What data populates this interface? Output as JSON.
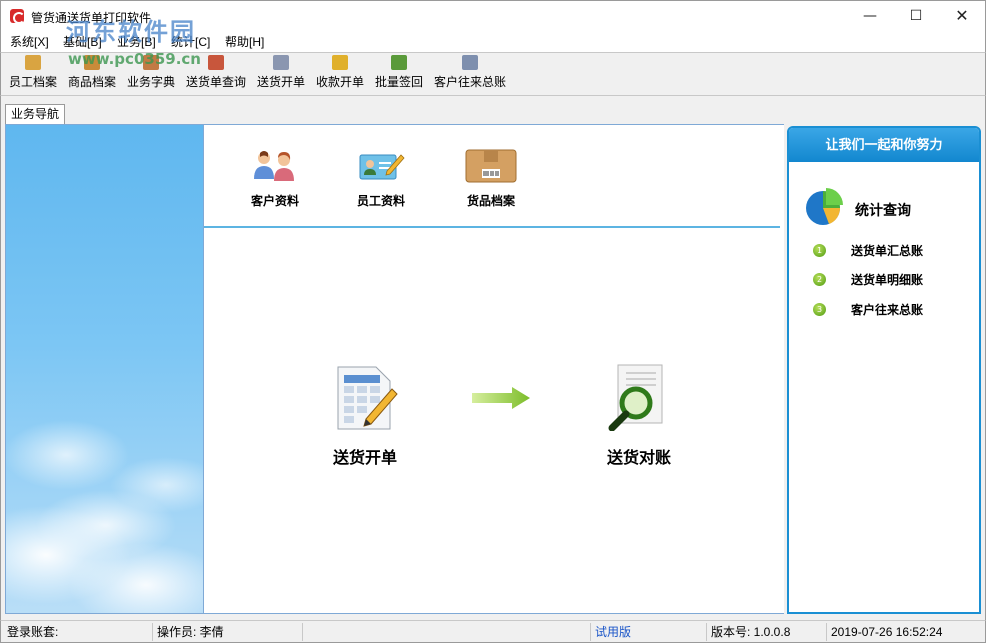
{
  "window": {
    "title": "管货通送货单打印软件",
    "watermark_text": "河东软件园",
    "watermark_url": "www.pc0359.cn",
    "minimize_glyph": "—",
    "maximize_glyph": "☐",
    "close_glyph": "✕"
  },
  "menu": {
    "items": [
      {
        "label": "系统[X]"
      },
      {
        "label": "基础[B]"
      },
      {
        "label": "业务[B]"
      },
      {
        "label": "统计[C]"
      },
      {
        "label": "帮助[H]"
      }
    ]
  },
  "toolbar": {
    "items": [
      {
        "label": "员工档案",
        "icon": "employee-icon",
        "color": "#d9a441"
      },
      {
        "label": "商品档案",
        "icon": "goods-icon",
        "color": "#c98b3a"
      },
      {
        "label": "业务字典",
        "icon": "dictionary-icon",
        "color": "#c27a44"
      },
      {
        "label": "送货单查询",
        "icon": "query-icon",
        "color": "#c8563c"
      },
      {
        "label": "送货开单",
        "icon": "delivery-icon",
        "color": "#8a96b0"
      },
      {
        "label": "收款开单",
        "icon": "payment-icon",
        "color": "#e0b02c"
      },
      {
        "label": "批量签回",
        "icon": "batch-sign-icon",
        "color": "#5a9a3a"
      },
      {
        "label": "客户往来总账",
        "icon": "ledger-icon",
        "color": "#7e8fae"
      }
    ]
  },
  "tabs": [
    {
      "label": "业务导航"
    }
  ],
  "quick_access": [
    {
      "label": "客户资料",
      "icon": "customers-icon"
    },
    {
      "label": "员工资料",
      "icon": "employee-card-icon"
    },
    {
      "label": "货品档案",
      "icon": "goods-box-icon"
    }
  ],
  "flow": {
    "start_label": "送货开单",
    "end_label": "送货对账"
  },
  "right_panel": {
    "header": "让我们一起和你努力",
    "section_title": "统计查询",
    "links": [
      {
        "num": "1",
        "label": "送货单汇总账"
      },
      {
        "num": "2",
        "label": "送货单明细账"
      },
      {
        "num": "3",
        "label": "客户往来总账"
      }
    ]
  },
  "status": {
    "account": "登录账套:",
    "operator": "操作员: 李倩",
    "trial": "试用版",
    "version": "版本号: 1.0.0.8",
    "datetime": "2019-07-26 16:52:24"
  },
  "colors": {
    "accent_blue": "#1a8fd3",
    "divider_blue": "#5cb4e2",
    "trial_text": "#1a55c8"
  }
}
